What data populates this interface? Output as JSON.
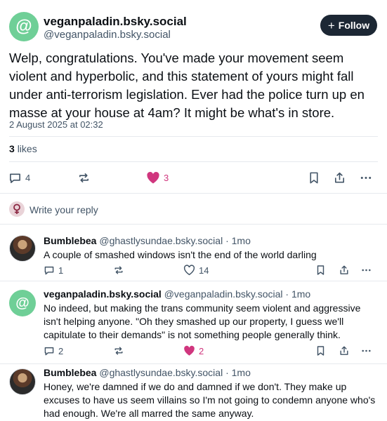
{
  "main_post": {
    "avatar_glyph": "@",
    "display_name": "veganpaladin.bsky.social",
    "handle": "@veganpaladin.bsky.social",
    "follow_label": "Follow",
    "follow_icon": "plus-icon",
    "text": "Welp, congratulations. You've made your movement seem violent and hyperbolic, and this statement of yours might fall under anti-terrorism legislation. Ever had the police turn up en masse at your house at 4am? It might be what's in store.",
    "timestamp": "2 August 2025 at 02:32",
    "likes_count": "3",
    "likes_label": "likes",
    "actions": {
      "replies": "4",
      "likes": "3"
    }
  },
  "reply_composer": {
    "placeholder": "Write your reply"
  },
  "replies": [
    {
      "name": "Bumblebea",
      "handle": "@ghastlysundae.bsky.social",
      "age": "1mo",
      "text": "A couple of smashed windows isn't the end of the world darling",
      "replies": "1",
      "likes": "14",
      "liked": false
    },
    {
      "avatar_glyph": "@",
      "name": "veganpaladin.bsky.social",
      "handle": "@veganpaladin.bsky.social",
      "age": "1mo",
      "text": "No indeed, but making the trans community seem violent and aggressive isn't helping anyone. \"Oh they smashed up our property, I guess we'll capitulate to their demands\" is not something people generally think.",
      "replies": "2",
      "likes": "2",
      "liked": true
    },
    {
      "name": "Bumblebea",
      "handle": "@ghastlysundae.bsky.social",
      "age": "1mo",
      "text": "Honey, we're damned if we do and damned if we don't. They make up excuses to have us seem villains so I'm not going to condemn anyone who's had enough. We're all marred the same anyway."
    }
  ],
  "separator": "·",
  "colors": {
    "accent_like": "#d0367e",
    "follow_bg": "#1c2734",
    "avatar_green": "#6fcf97",
    "muted": "#425466"
  }
}
